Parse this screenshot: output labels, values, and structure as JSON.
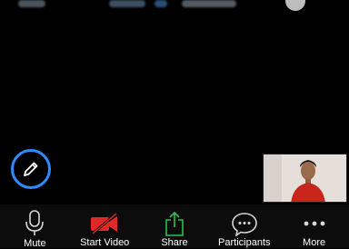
{
  "toolbar": {
    "items": [
      {
        "label": "Mute",
        "icon": "microphone-icon"
      },
      {
        "label": "Start Video",
        "icon": "video-off-icon"
      },
      {
        "label": "Share",
        "icon": "share-icon"
      },
      {
        "label": "Participants",
        "icon": "participants-icon"
      },
      {
        "label": "More",
        "icon": "more-icon"
      }
    ]
  },
  "colors": {
    "accent": "#2d8cff",
    "video_off": "#e02828",
    "share": "#27c24c",
    "background": "#000000"
  }
}
